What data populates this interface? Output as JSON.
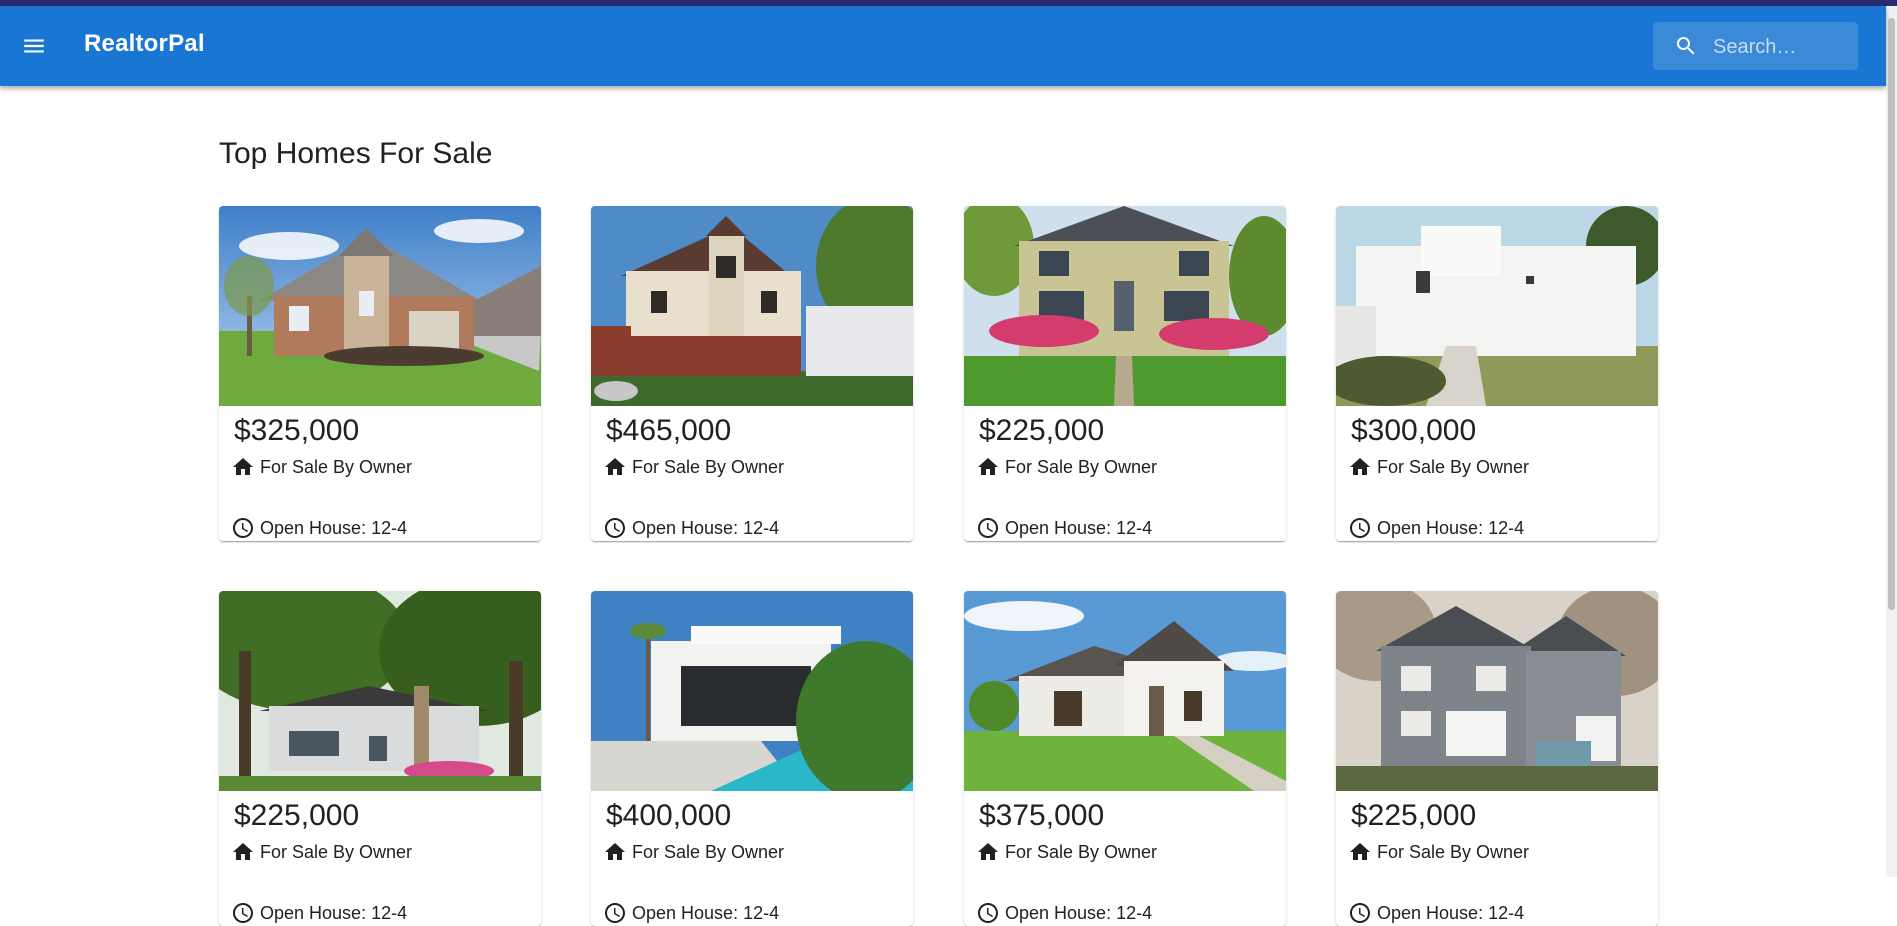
{
  "app": {
    "title": "RealtorPal",
    "search_placeholder": "Search…",
    "menu_icon": "menu-icon",
    "search_icon": "search-icon",
    "accent_color": "#1976d2"
  },
  "main": {
    "heading": "Top Homes For Sale",
    "listings": [
      {
        "price": "$325,000",
        "sale_type": "For Sale By Owner",
        "open_house": "Open House: 12-4",
        "photo": "brick-suburban-house"
      },
      {
        "price": "$465,000",
        "sale_type": "For Sale By Owner",
        "open_house": "Open House: 12-4",
        "photo": "victorian-house"
      },
      {
        "price": "$225,000",
        "sale_type": "For Sale By Owner",
        "open_house": "Open House: 12-4",
        "photo": "colonial-house-with-flowers"
      },
      {
        "price": "$300,000",
        "sale_type": "For Sale By Owner",
        "open_house": "Open House: 12-4",
        "photo": "white-modern-house"
      },
      {
        "price": "$225,000",
        "sale_type": "For Sale By Owner",
        "open_house": "Open House: 12-4",
        "photo": "cottage-under-trees"
      },
      {
        "price": "$400,000",
        "sale_type": "For Sale By Owner",
        "open_house": "Open House: 12-4",
        "photo": "modern-house-with-pool"
      },
      {
        "price": "$375,000",
        "sale_type": "For Sale By Owner",
        "open_house": "Open House: 12-4",
        "photo": "white-stucco-house"
      },
      {
        "price": "$225,000",
        "sale_type": "For Sale By Owner",
        "open_house": "Open House: 12-4",
        "photo": "stone-two-story-house"
      }
    ]
  }
}
